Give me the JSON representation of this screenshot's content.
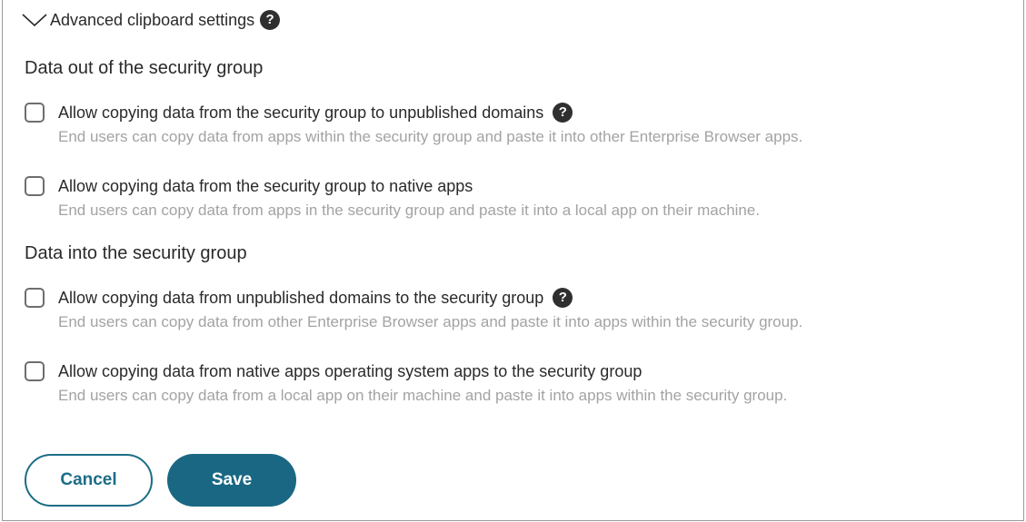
{
  "header": {
    "title": "Advanced clipboard settings",
    "help_glyph": "?"
  },
  "groups": [
    {
      "title": "Data out of the security group",
      "options": [
        {
          "label": "Allow copying data from the security group to unpublished domains",
          "description": "End users can copy data from apps within the security group and paste it into other Enterprise Browser apps.",
          "checked": false,
          "has_help": true
        },
        {
          "label": "Allow copying data from the security group to native apps",
          "description": "End users can copy data from apps in the security group and paste it into a local app on their machine.",
          "checked": false,
          "has_help": false
        }
      ]
    },
    {
      "title": "Data into the security group",
      "options": [
        {
          "label": "Allow copying data from unpublished domains to the security group",
          "description": "End users can copy data from other Enterprise Browser apps and paste it into apps within the security group.",
          "checked": false,
          "has_help": true
        },
        {
          "label": "Allow copying data from native apps operating system apps to the security group",
          "description": "End users can copy data from a local app on their machine and paste it into apps within the security group.",
          "checked": false,
          "has_help": false
        }
      ]
    }
  ],
  "buttons": {
    "cancel_label": "Cancel",
    "save_label": "Save"
  },
  "icons": {
    "header_toggle": "chevron-down-icon",
    "help": "help-icon"
  },
  "colors": {
    "primary": "#1a6783",
    "primary_outline": "#1c6d87",
    "description_text": "#a3a3a3",
    "help_icon_bg": "#2f2f2f"
  }
}
